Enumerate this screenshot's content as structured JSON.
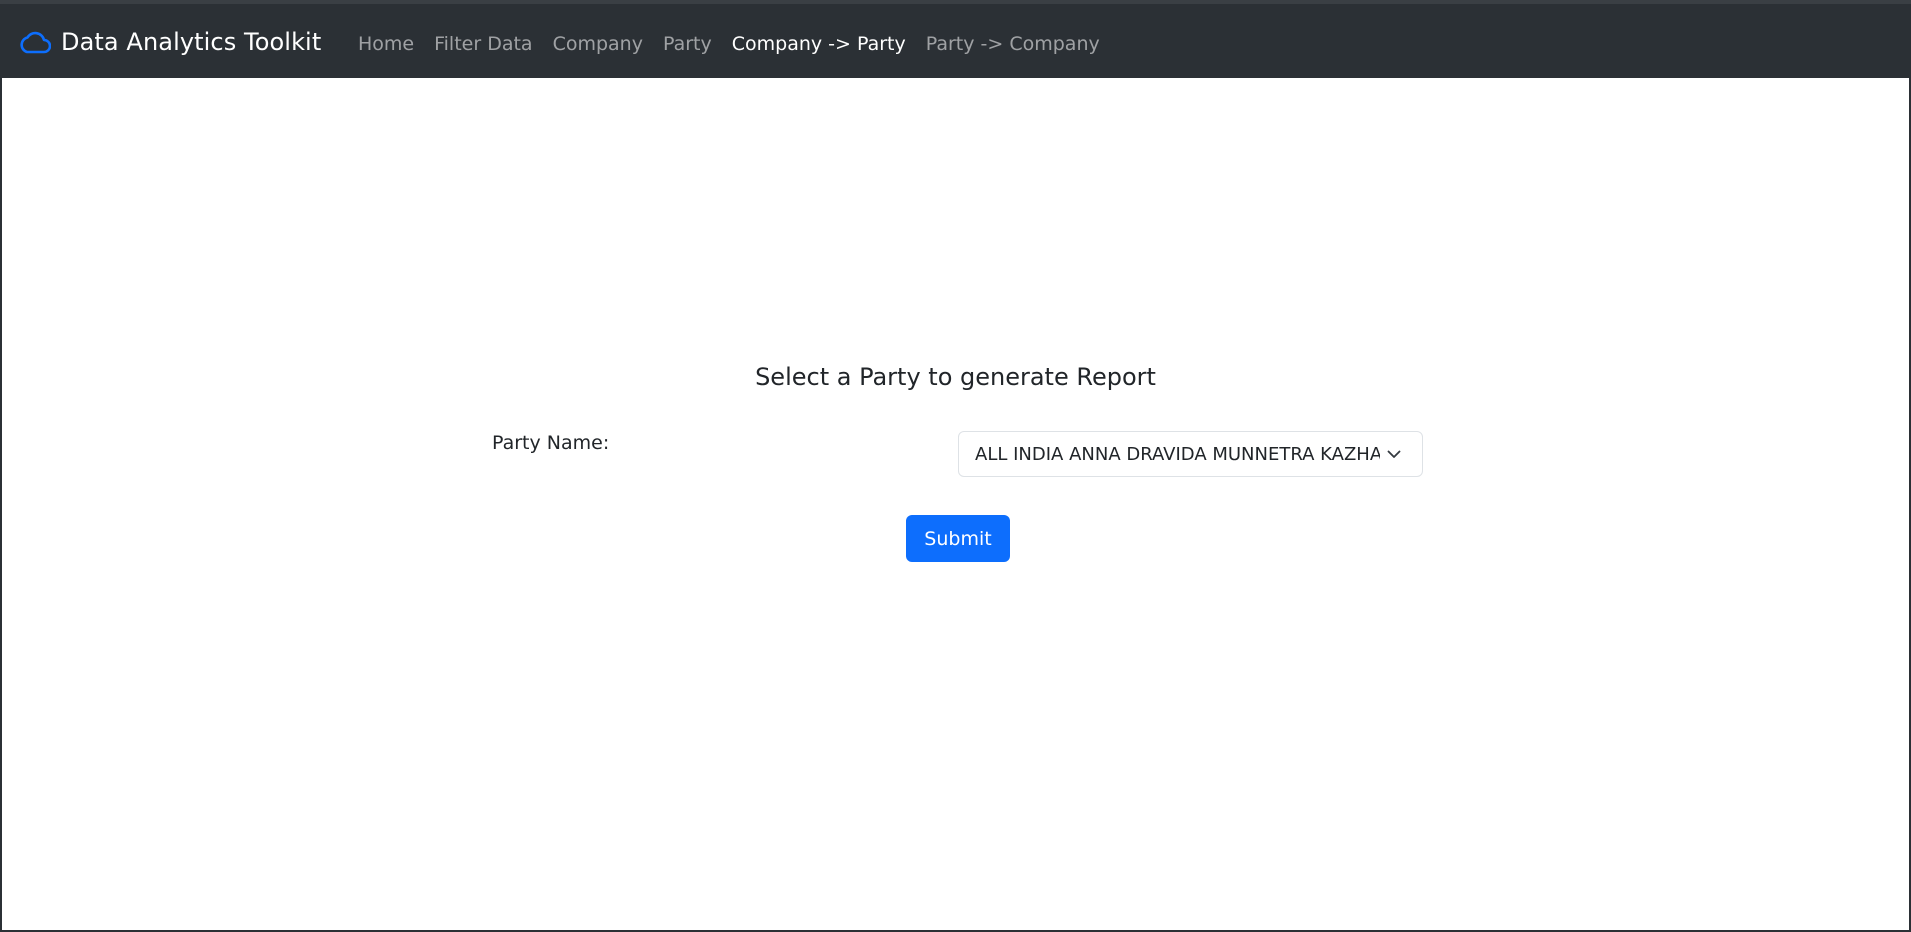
{
  "navbar": {
    "brand_icon": "cloud-icon",
    "brand_title": "Data Analytics Toolkit",
    "links": [
      {
        "label": "Home",
        "active": false
      },
      {
        "label": "Filter Data",
        "active": false
      },
      {
        "label": "Company",
        "active": false
      },
      {
        "label": "Party",
        "active": false
      },
      {
        "label": "Company -> Party",
        "active": true
      },
      {
        "label": "Party -> Company",
        "active": false
      }
    ]
  },
  "form": {
    "heading": "Select a Party to generate Report",
    "party_label": "Party Name:",
    "party_selected": "ALL INDIA ANNA DRAVIDA MUNNETRA KAZHAGAM",
    "submit_label": "Submit"
  },
  "colors": {
    "navbar_bg": "#2b3035",
    "brand_icon": "#0d6efd",
    "primary_button": "#0d6efd"
  }
}
